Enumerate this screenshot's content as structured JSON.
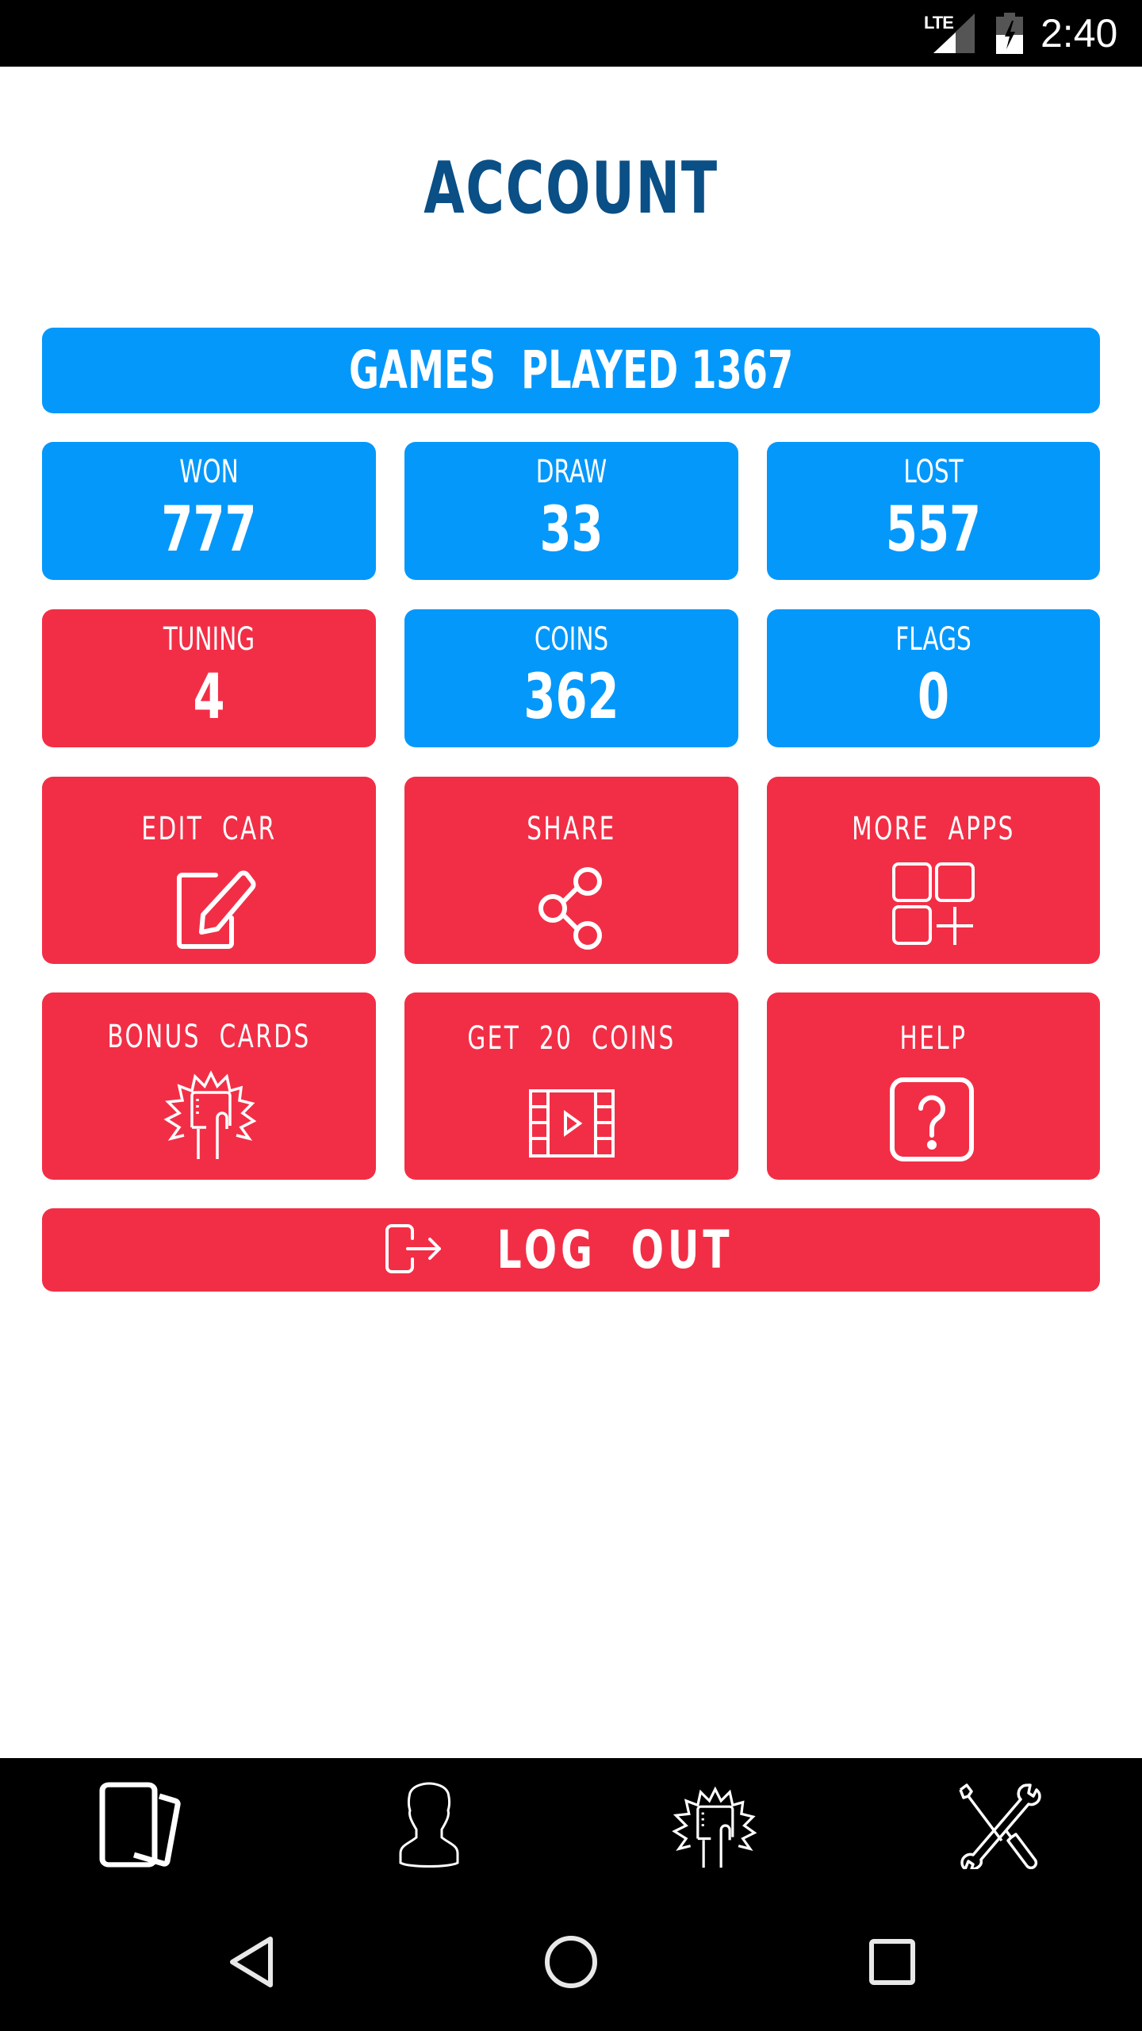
{
  "status_bar": {
    "network": "LTE",
    "time": "2:40",
    "icons": [
      "signal-icon",
      "battery-charging-icon"
    ]
  },
  "header": {
    "title": "ACCOUNT"
  },
  "games_played": {
    "label": "GAMES  PLAYED",
    "value": "1367"
  },
  "stats": [
    {
      "label": "WON",
      "value": "777",
      "color": "#0598fb"
    },
    {
      "label": "DRAW",
      "value": "33",
      "color": "#0598fb"
    },
    {
      "label": "LOST",
      "value": "557",
      "color": "#0598fb"
    },
    {
      "label": "TUNING",
      "value": "4",
      "color": "#f22e46"
    },
    {
      "label": "COINS",
      "value": "362",
      "color": "#0598fb"
    },
    {
      "label": "FLAGS",
      "value": "0",
      "color": "#0598fb"
    }
  ],
  "actions": [
    {
      "label": "EDIT  CAR",
      "icon": "edit-icon"
    },
    {
      "label": "SHARE",
      "icon": "share-icon"
    },
    {
      "label": "MORE  APPS",
      "icon": "more-apps-icon"
    },
    {
      "label": "BONUS  CARDS",
      "icon": "bonus-card-icon"
    },
    {
      "label": "GET  20  COINS",
      "icon": "video-icon"
    },
    {
      "label": "HELP",
      "icon": "help-icon"
    }
  ],
  "logout": {
    "label": "LOG  OUT",
    "icon": "logout-icon"
  },
  "tab_bar": [
    {
      "name": "cards",
      "icon": "cards-icon"
    },
    {
      "name": "account",
      "icon": "person-icon"
    },
    {
      "name": "bonus",
      "icon": "bonus-card-icon"
    },
    {
      "name": "settings",
      "icon": "tools-icon"
    }
  ],
  "nav_bar": [
    {
      "name": "back",
      "icon": "back-icon"
    },
    {
      "name": "home",
      "icon": "home-icon"
    },
    {
      "name": "recents",
      "icon": "recents-icon"
    }
  ],
  "colors": {
    "title": "#0a4f86",
    "blue": "#0598fb",
    "red": "#f22e46"
  }
}
